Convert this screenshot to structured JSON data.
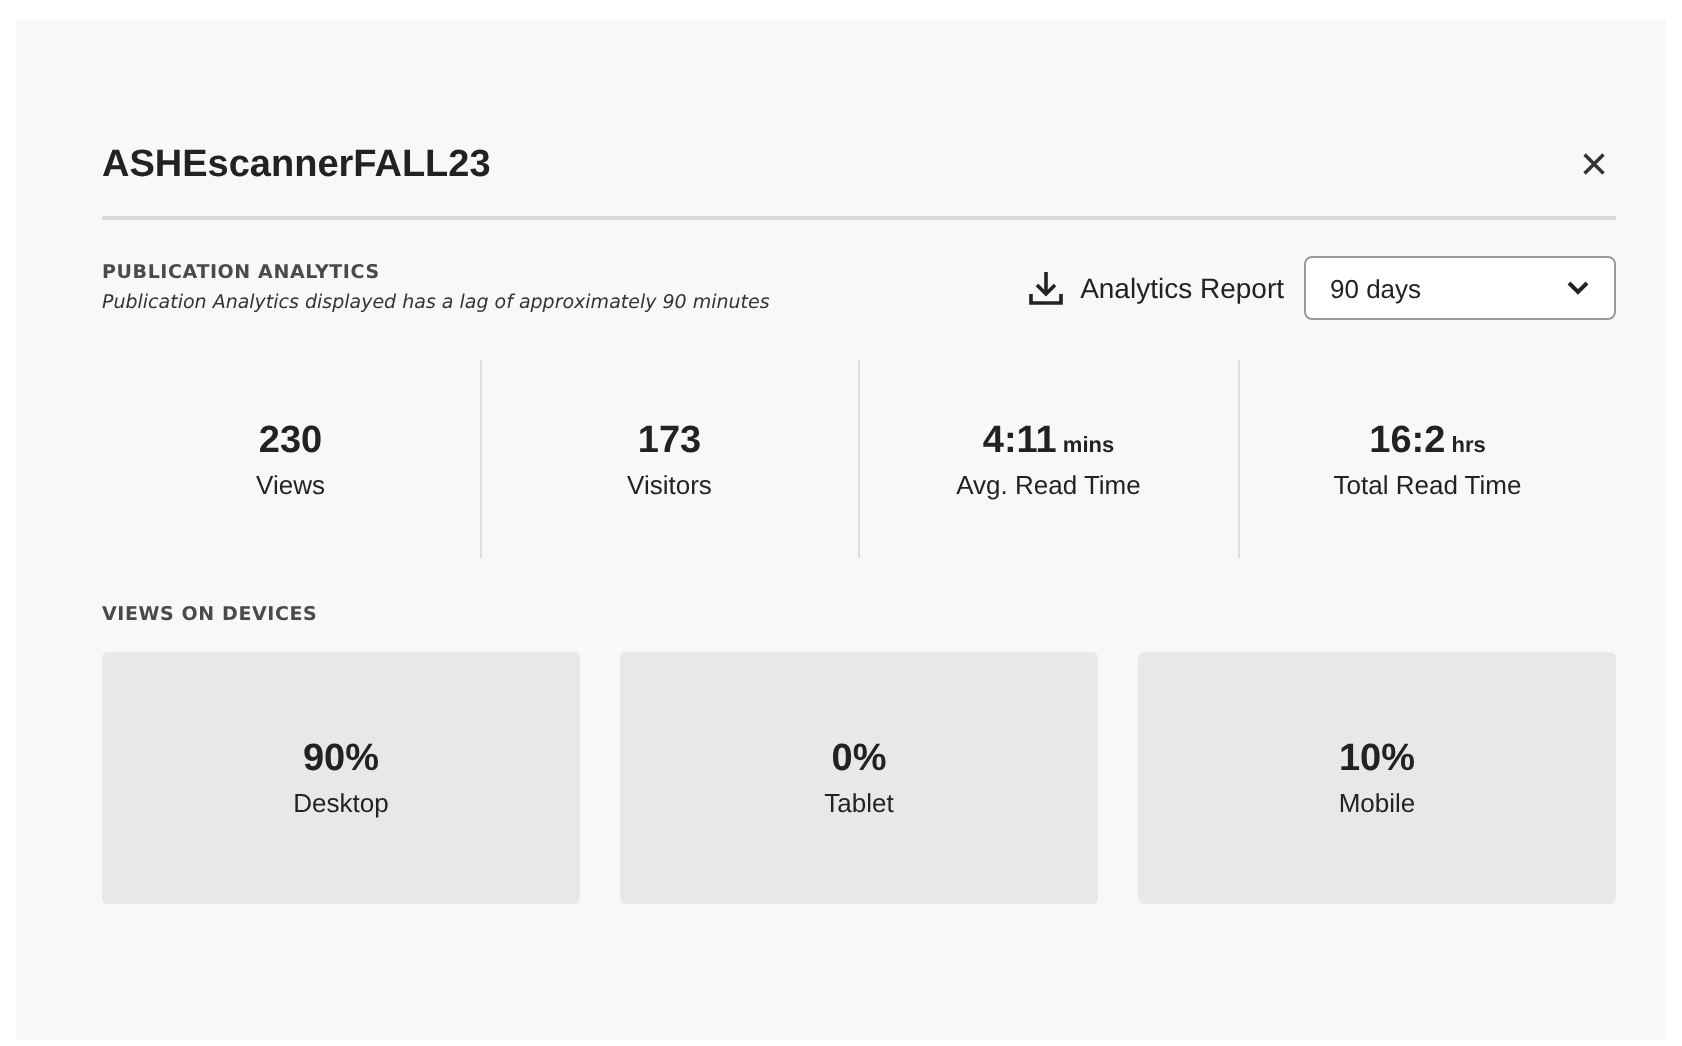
{
  "dialog": {
    "title": "ASHEscannerFALL23",
    "close": "×"
  },
  "analytics": {
    "heading": "PUBLICATION ANALYTICS",
    "note": "Publication Analytics displayed has a lag of approximately 90 minutes",
    "report_button": "Analytics Report",
    "period": {
      "value": "90 days"
    }
  },
  "stats": [
    {
      "value": "230",
      "label": "Views"
    },
    {
      "value": "173",
      "label": "Visitors"
    },
    {
      "value": "4:11",
      "unit": "mins",
      "label": "Avg. Read Time"
    },
    {
      "value": "16:2",
      "unit": "hrs",
      "label": "Total Read Time"
    }
  ],
  "devices": {
    "heading": "VIEWS ON DEVICES",
    "items": [
      {
        "value": "90%",
        "label": "Desktop"
      },
      {
        "value": "0%",
        "label": "Tablet"
      },
      {
        "value": "10%",
        "label": "Mobile"
      }
    ]
  }
}
